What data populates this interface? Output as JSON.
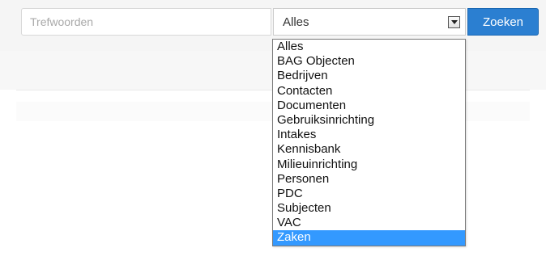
{
  "search": {
    "placeholder": "Trefwoorden",
    "value": ""
  },
  "category_select": {
    "selected_label": "Alles",
    "arrow_icon": "chevron-down-icon",
    "options": [
      "Alles",
      "BAG Objecten",
      "Bedrijven",
      "Contacten",
      "Documenten",
      "Gebruiksinrichting",
      "Intakes",
      "Kennisbank",
      "Milieuinrichting",
      "Personen",
      "PDC",
      "Subjecten",
      "VAC",
      "Zaken"
    ],
    "highlighted_option": "Zaken"
  },
  "search_button": {
    "label": "Zoeken"
  },
  "colors": {
    "button": "#2b7fd1",
    "highlight": "#3399ff",
    "topbar": "#f5f5f5"
  }
}
